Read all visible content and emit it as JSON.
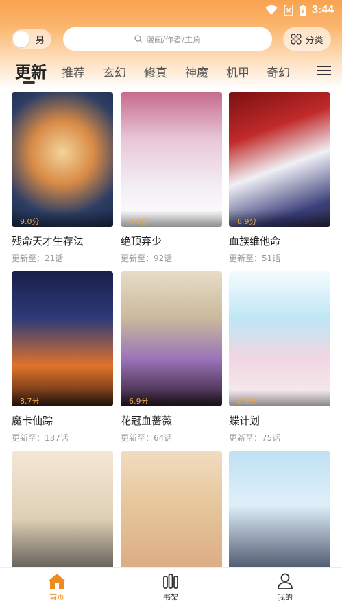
{
  "status_bar": {
    "time": "3:44"
  },
  "header": {
    "gender_label": "男",
    "search_placeholder": "漫画/作者/主角",
    "category_label": "分类"
  },
  "tabs": [
    {
      "label": "更新",
      "active": true
    },
    {
      "label": "推荐"
    },
    {
      "label": "玄幻"
    },
    {
      "label": "修真"
    },
    {
      "label": "神魔"
    },
    {
      "label": "机甲"
    },
    {
      "label": "奇幻"
    }
  ],
  "comics": [
    {
      "title": "残命天才生存法",
      "rating": "9.0分",
      "update": "更新至：21话"
    },
    {
      "title": "绝顶弃少",
      "rating": "9.0分",
      "update": "更新至：92话"
    },
    {
      "title": "血族维他命",
      "rating": "8.9分",
      "update": "更新至：51话"
    },
    {
      "title": "魔卡仙踪",
      "rating": "8.7分",
      "update": "更新至：137话"
    },
    {
      "title": "花冠血蔷薇",
      "rating": "6.9分",
      "update": "更新至：64话"
    },
    {
      "title": "蝶计划",
      "rating": "8.6分",
      "update": "更新至：75话"
    },
    {
      "title": "",
      "rating": "",
      "update": ""
    },
    {
      "title": "",
      "rating": "",
      "update": ""
    },
    {
      "title": "",
      "rating": "",
      "update": ""
    }
  ],
  "bottom_nav": [
    {
      "label": "首页",
      "icon": "home-icon",
      "active": true
    },
    {
      "label": "书架",
      "icon": "bookshelf-icon"
    },
    {
      "label": "我的",
      "icon": "profile-icon"
    }
  ],
  "colors": {
    "accent": "#f08a1e",
    "header_gradient_top": "#f9a24f",
    "rating_text": "#e8a54a"
  }
}
